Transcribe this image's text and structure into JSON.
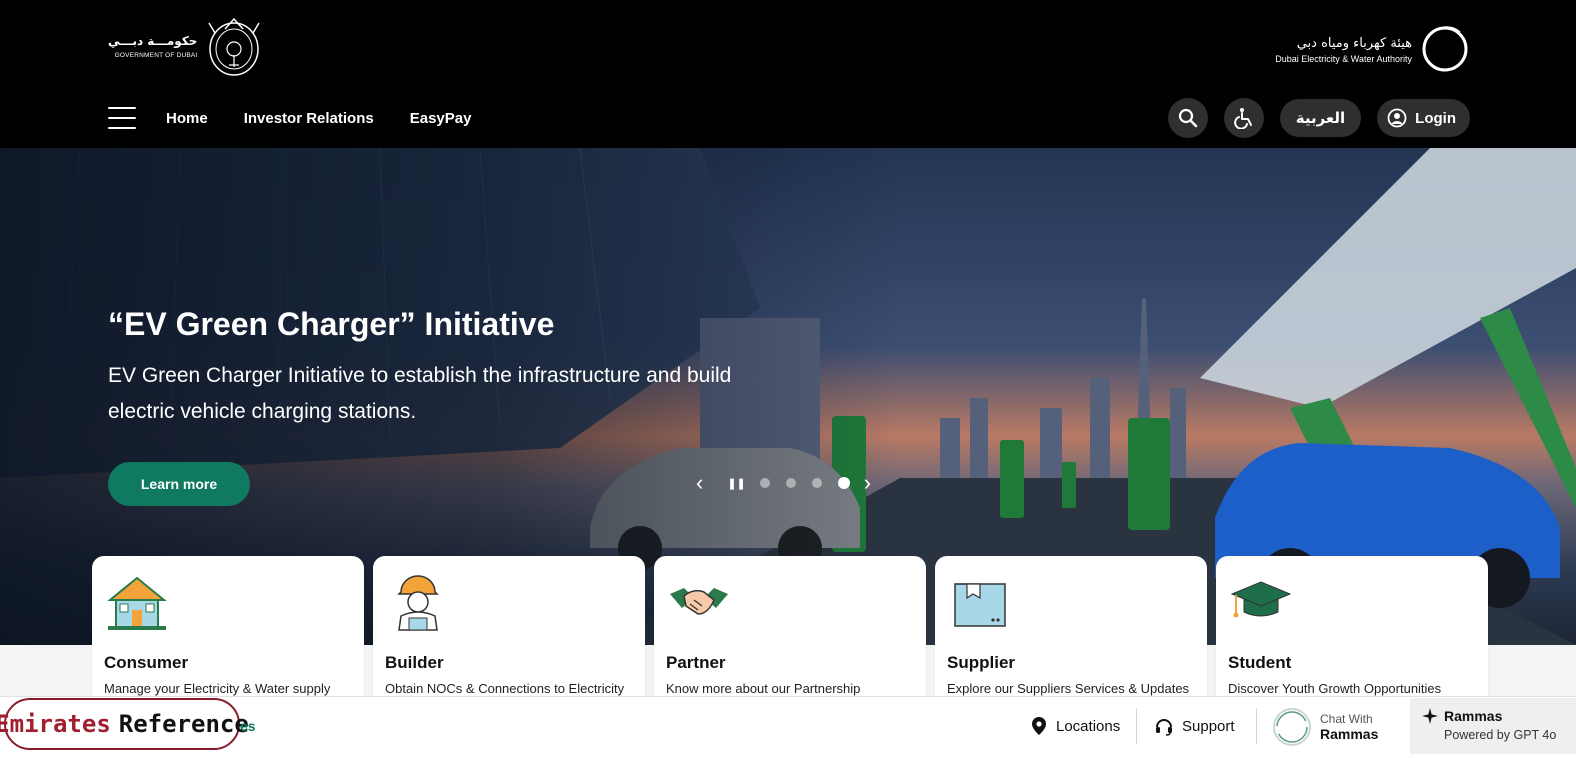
{
  "header": {
    "gov_logo": {
      "arabic": "حكومـــة دبـــي",
      "english": "GOVERNMENT OF DUBAI"
    },
    "dewa_logo": {
      "arabic": "هيئة كهرباء ومياه دبي",
      "english": "Dubai Electricity & Water Authority"
    },
    "nav": [
      "Home",
      "Investor Relations",
      "EasyPay"
    ],
    "language_label": "العربية",
    "login_label": "Login",
    "icons": {
      "menu": "hamburger-icon",
      "search": "search-icon",
      "accessibility": "accessibility-icon",
      "user": "user-circle-icon"
    }
  },
  "hero": {
    "title": "“EV Green Charger” Initiative",
    "subtitle": "EV Green Charger Initiative to establish the infrastructure and build electric vehicle charging stations.",
    "cta_label": "Learn more",
    "carousel": {
      "prev": "‹",
      "next": "›",
      "pause": "❚❚",
      "slide_count": 4,
      "active_slide": 4
    }
  },
  "cards": [
    {
      "title": "Consumer",
      "desc": "Manage your Electricity & Water supply",
      "icon": "house-icon"
    },
    {
      "title": "Builder",
      "desc": "Obtain NOCs & Connections to Electricity",
      "icon": "builder-icon"
    },
    {
      "title": "Partner",
      "desc": "Know more about our Partnership",
      "icon": "handshake-icon"
    },
    {
      "title": "Supplier",
      "desc": "Explore our Suppliers Services & Updates",
      "icon": "box-icon"
    },
    {
      "title": "Student",
      "desc": "Discover Youth Growth Opportunities",
      "icon": "graduation-cap-icon"
    }
  ],
  "bottom_bar": {
    "watermark": {
      "part1": "Emirates",
      "part2": "Reference"
    },
    "fragment": "es",
    "locations_label": "Locations",
    "support_label": "Support",
    "chat_with": "Chat With",
    "chat_name": "Rammas",
    "rammas_title": "Rammas",
    "rammas_sub": "Powered by GPT 4o"
  },
  "colors": {
    "accent": "#0f7a5f",
    "header_bg": "#000000"
  }
}
